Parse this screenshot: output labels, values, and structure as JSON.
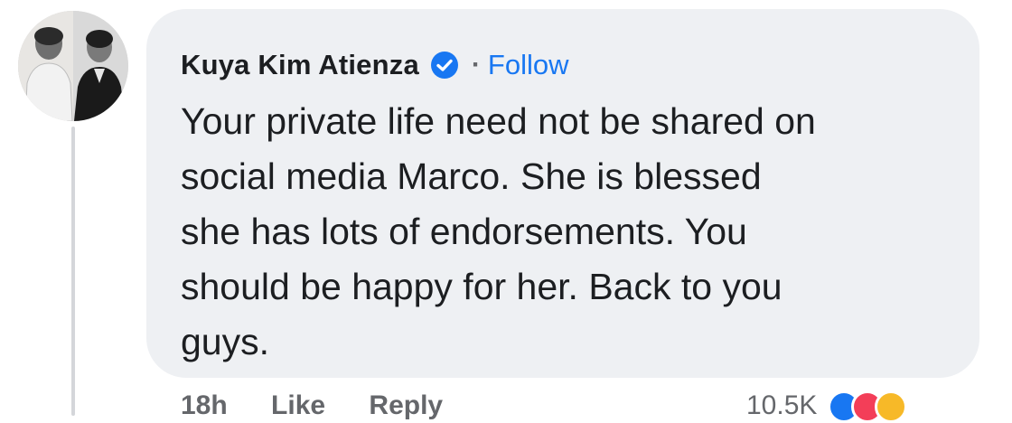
{
  "comment": {
    "author": "Kuya Kim Atienza",
    "separator": "·",
    "follow_label": "Follow",
    "text_lines": [
      "Your private life need not be shared on",
      "social media Marco. She is blessed",
      "she has lots of endorsements. You",
      "should be happy for her. Back to you",
      "guys."
    ]
  },
  "footer": {
    "time": "18h",
    "like_label": "Like",
    "reply_label": "Reply",
    "reaction_count": "10.5K",
    "reactions": [
      "like-icon",
      "love-icon",
      "haha-icon"
    ]
  },
  "colors": {
    "bubble": "#eef0f3",
    "link": "#1877f2",
    "verified": "#1877f2",
    "text": "#1c1e21",
    "muted": "#65676b"
  },
  "icons": {
    "verified": "verified-badge-icon"
  }
}
